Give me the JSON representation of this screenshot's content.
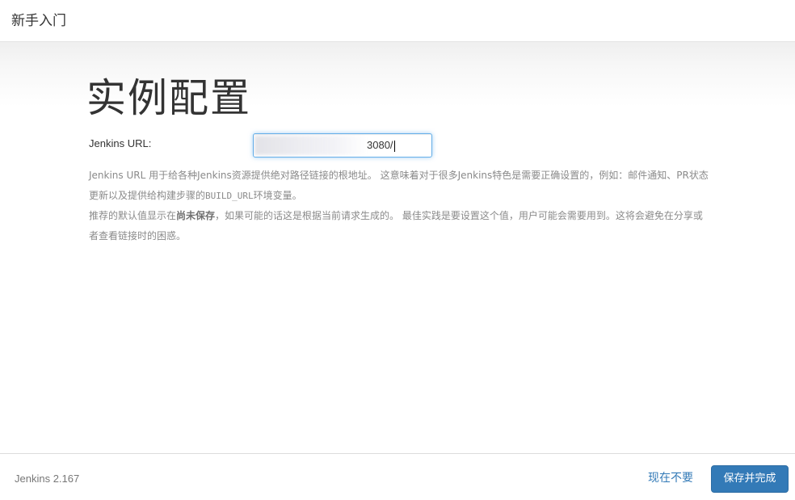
{
  "header": {
    "title": "新手入门"
  },
  "main": {
    "page_title": "实例配置",
    "url_label": "Jenkins URL:",
    "url_input_value": "3080/",
    "help": {
      "line1": "Jenkins URL 用于给各种Jenkins资源提供绝对路径链接的根地址。 这意味着对于很多Jenkins特色是需要正确设置的，例如：邮件通知、PR状态",
      "line2_prefix": "更新以及提供给构建步骤的",
      "line2_code": "BUILD_URL",
      "line2_suffix": "环境变量。",
      "line3_prefix": "推荐的默认值显示在",
      "line3_bold": "尚未保存",
      "line3_suffix": "，如果可能的话这是根据当前请求生成的。 最佳实践是要设置这个值，用户可能会需要用到。这将会避免在分享或",
      "line4": "者查看链接时的困惑。"
    }
  },
  "footer": {
    "version": "Jenkins 2.167",
    "skip_label": "现在不要",
    "save_label": "保存并完成"
  },
  "colors": {
    "primary_button": "#337ab7",
    "link": "#337ab7",
    "focus_border": "#66afe9"
  }
}
